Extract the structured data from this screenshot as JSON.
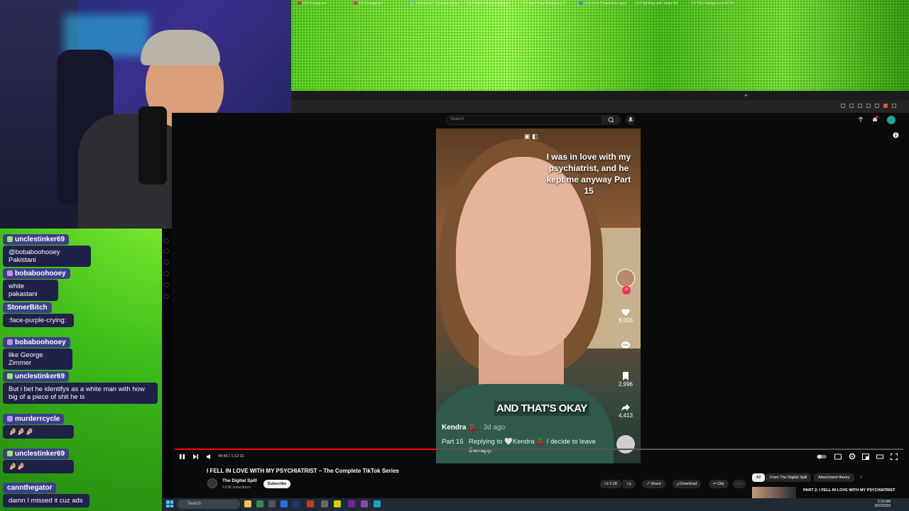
{
  "browser_tabs": [
    {
      "label": "(2) Instagram",
      "icon": "instagram-icon"
    },
    {
      "label": "(2) Instagram",
      "icon": "instagram-icon"
    },
    {
      "label": "Inensince - Google Sear",
      "icon": "google-icon"
    },
    {
      "label": "(7) Feline Desires (Maxx",
      "icon": "youtube-icon"
    },
    {
      "label": "(7) Wet Your Whiskers O",
      "icon": "youtube-icon"
    },
    {
      "label": "List of In Treatment epis",
      "icon": "doc-icon"
    },
    {
      "label": "(7) Fighting with Maki Ba",
      "icon": "youtube-icon"
    },
    {
      "label": "(7) The Dangers of AI Po",
      "icon": "youtube-icon"
    }
  ],
  "new_tab": "+",
  "youtube": {
    "search_placeholder": "Search"
  },
  "chat": [
    {
      "user": "unclestinker69",
      "badge": "green",
      "text": "@bobaboohooey Pakistani"
    },
    {
      "user": "bobaboohooey",
      "badge": "purple",
      "text": "white pakastani"
    },
    {
      "user": "StonerBitch",
      "badge": "",
      "text": ":face-purple-crying:"
    },
    {
      "user": "bobaboohooey",
      "badge": "purple",
      "text": "like George Zimmer"
    },
    {
      "user": "unclestinker69",
      "badge": "green",
      "text": "But i bet he identifys as a white man with how big of a piece of shit he is"
    },
    {
      "user": "murderrcycle",
      "badge": "purple",
      "text": "🤌🏼🤌🏼🤌🏼"
    },
    {
      "user": "unclestinker69",
      "badge": "green",
      "text": "🤌🏼🤌🏼"
    },
    {
      "user": "cannthegator",
      "badge": "",
      "text": "damn I missed it cuz ads"
    }
  ],
  "video": {
    "overlay_text": "I was in love with my psychiatrist, and he kept me anyway Part 15",
    "caption": "AND THAT'S OKAY",
    "creator": "Kendra 🍒",
    "creator_age": "· 3d ago",
    "part_label": "Part 15",
    "reply_text": "Replying to 🤍Kendra 🍒  I decide to leave therapy.",
    "likes": "8,003",
    "saves": "2,996",
    "shares": "4,413",
    "progress": 0.36,
    "time_display": "44:40 / 1:12:31"
  },
  "video_title": "I FELL IN LOVE WITH MY PSYCHIATRIST – The Complete TikTok Series",
  "channel": {
    "name": "The Digital Spill",
    "subscribers": "6.63K subscribers",
    "subscribe_label": "Subscribe"
  },
  "actions": {
    "likes": "2.1K",
    "share": "Share",
    "download": "Download",
    "clip": "Clip",
    "more": "···"
  },
  "chips": {
    "all": "All",
    "from_channel": "From The Digital Spill",
    "attachment": "Attachment theory"
  },
  "recommended": {
    "title": "PART 2: I FELL IN LOVE WITH MY PSYCHIATRIST"
  },
  "taskbar": {
    "search_placeholder": "Search",
    "time": "2:30 AM",
    "date": "8/23/2025"
  },
  "colors": {
    "accent_red": "#ff0000",
    "chat_user_bg": "#3c3f8a",
    "chat_text_bg": "#1f2148"
  }
}
